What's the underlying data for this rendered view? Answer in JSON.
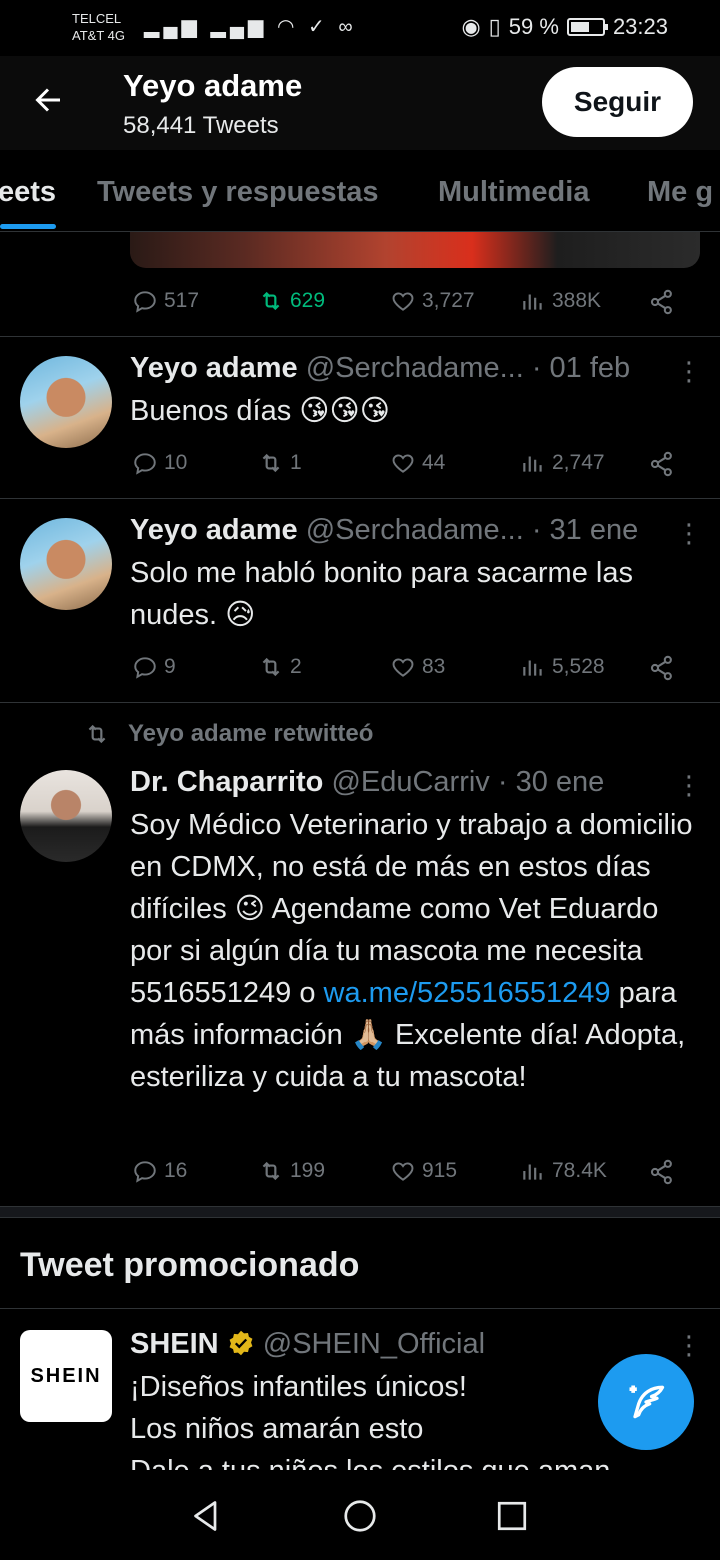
{
  "status_bar": {
    "carrier_1": "TELCEL",
    "carrier_2": "AT&T 4G",
    "battery": "59 %",
    "time": "23:23"
  },
  "header": {
    "name": "Yeyo adame",
    "tweet_count": "58,441 Tweets",
    "follow_label": "Seguir"
  },
  "tabs": [
    {
      "label": "Tweets",
      "shown": "eets",
      "active": true
    },
    {
      "label": "Tweets y respuestas"
    },
    {
      "label": "Multimedia"
    },
    {
      "label": "Me g",
      "shown": "Me g"
    }
  ],
  "tweets": [
    {
      "stats": {
        "replies": "517",
        "retweets": "629",
        "likes": "3,727",
        "views": "388K"
      }
    },
    {
      "name": "Yeyo adame",
      "handle": "@Serchadame...",
      "date": "· 01 feb",
      "text": "Buenos días 😘😘😘",
      "stats": {
        "replies": "10",
        "retweets": "1",
        "likes": "44",
        "views": "2,747"
      }
    },
    {
      "name": "Yeyo adame",
      "handle": "@Serchadame...",
      "date": "· 31 ene",
      "text": "Solo me habló bonito para sacarme las nudes. 😥",
      "stats": {
        "replies": "9",
        "retweets": "2",
        "likes": "83",
        "views": "5,528"
      }
    },
    {
      "retweeted_by": "Yeyo adame retwitteó",
      "name": "Dr. Chaparrito",
      "handle": "@EduCarriv",
      "date": "· 30 ene",
      "text_1": "Soy Médico Veterinario y trabajo a domicilio en CDMX, no está de más en estos días difíciles 😉 Agendame como Vet Eduardo por si algún día tu mascota me necesita 5516551249 o ",
      "link": "wa.me/525516551249",
      "text_2": " para más información 🙏🏼 Excelente día! Adopta, esteriliza y cuida a tu mascota!",
      "stats": {
        "replies": "16",
        "retweets": "199",
        "likes": "915",
        "views": "78.4K"
      }
    }
  ],
  "promoted": {
    "section_title": "Tweet promocionado",
    "logo_text": "SHEIN",
    "name": "SHEIN",
    "handle": "@SHEIN_Official",
    "text_1": "¡Diseños infantiles únicos!",
    "text_2": "Los niños amarán esto",
    "text_3": "Dale a tus niños los estilos que aman"
  },
  "colors": {
    "accent": "#1d9bf0",
    "retweet_active": "#00ba7c",
    "muted": "#71767b",
    "verified_gold": "#e2b719"
  }
}
